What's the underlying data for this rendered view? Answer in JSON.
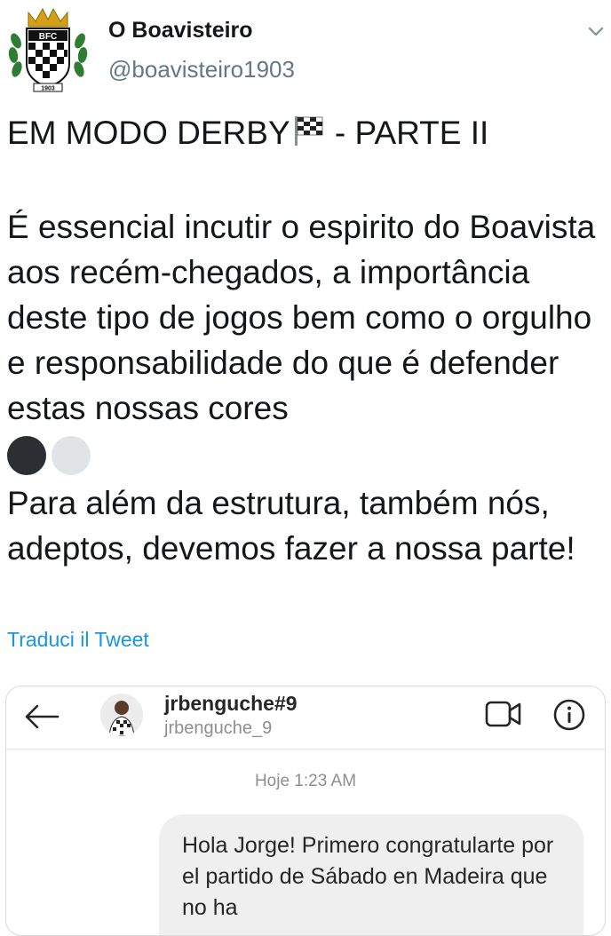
{
  "account": {
    "name": "O Boavisteiro",
    "handle": "@boavisteiro1903",
    "avatar_icon": "boavista-crest-icon",
    "crest_letters": "BFC",
    "crest_year": "1903"
  },
  "tweet": {
    "title": "EM MODO DERBY",
    "title_suffix": " - PARTE II",
    "paragraph1": "É essencial incutir o espirito do Boavista aos recém-chegados, a importância deste tipo de jogos bem como o orgulho e responsabilidade do que é defender estas nossas cores",
    "paragraph2": "Para além da estrutura, também nós, adeptos, devemos fazer a nossa parte!",
    "translate_link": "Traduci il Tweet",
    "emoji_colors": [
      "#2b2f33",
      "#e1e4e7"
    ]
  },
  "embedded_dm": {
    "contact_name": "jrbenguche#9",
    "contact_username": "jrbenguche_9",
    "timestamp": "Hoje 1:23 AM",
    "message": "Hola Jorge! Primero congratularte por el partido de Sábado en Madeira que no ha"
  },
  "colors": {
    "link": "#1b95e0",
    "secondary_text": "#657786"
  }
}
